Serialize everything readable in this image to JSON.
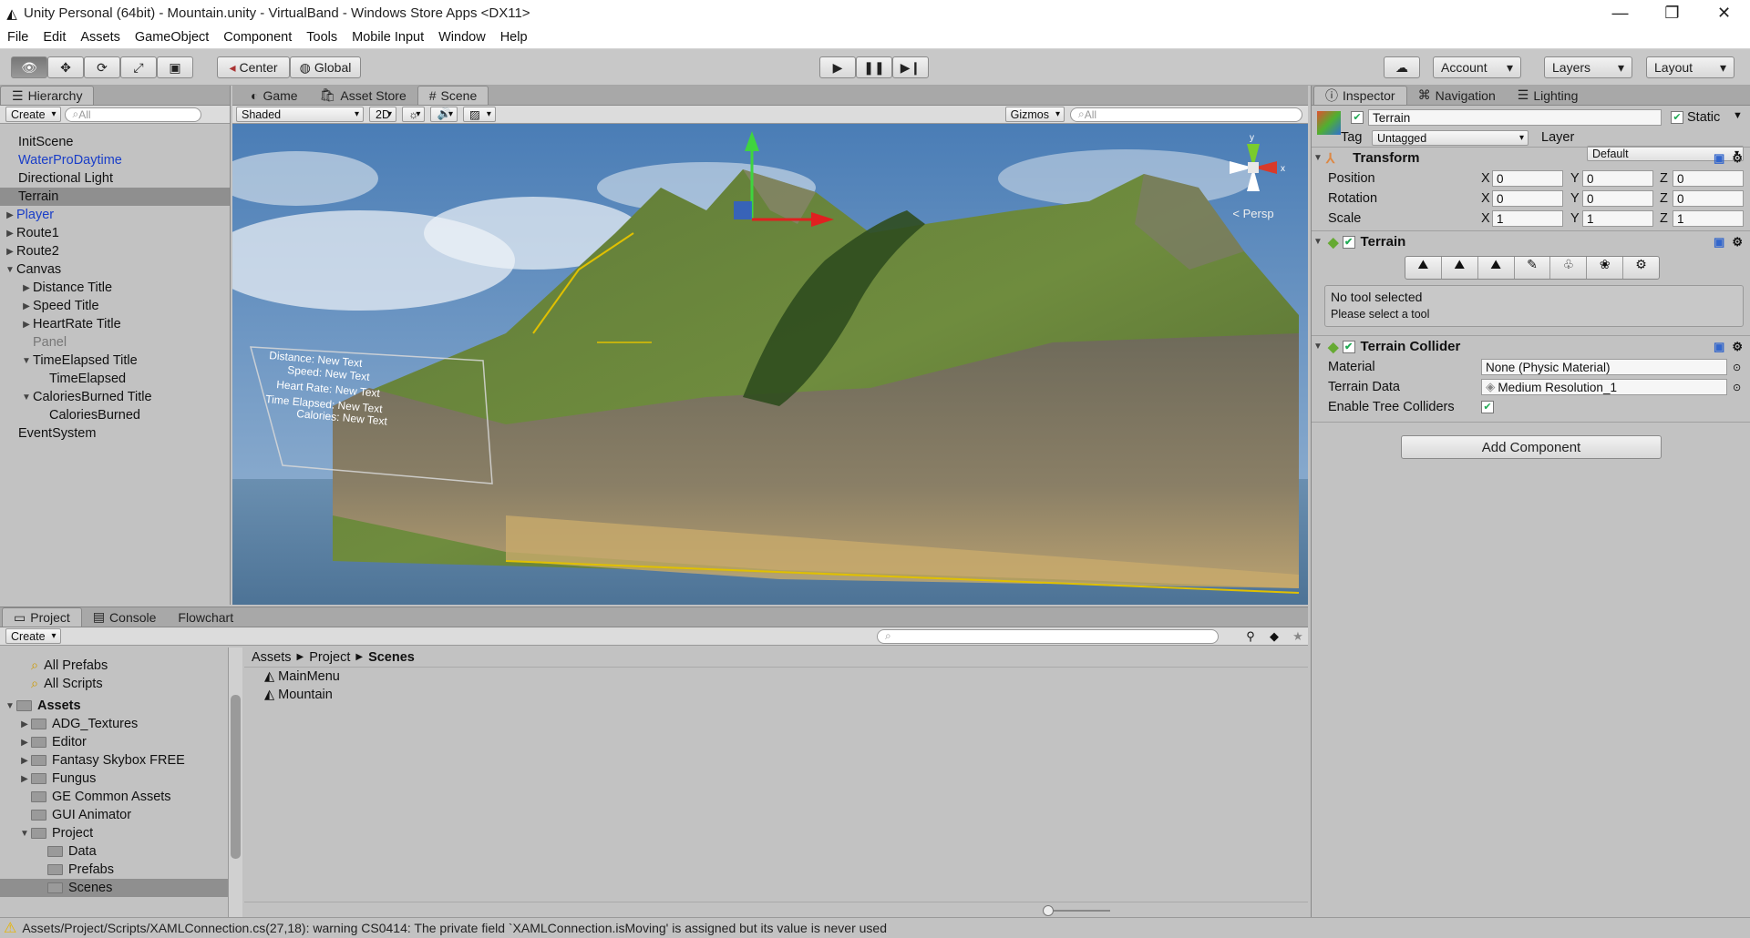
{
  "window": {
    "title": "Unity Personal (64bit) - Mountain.unity - VirtualBand - Windows Store Apps <DX11>"
  },
  "menu": [
    "File",
    "Edit",
    "Assets",
    "GameObject",
    "Component",
    "Tools",
    "Mobile Input",
    "Window",
    "Help"
  ],
  "toolbar": {
    "center": "Center",
    "global": "Global",
    "account": "Account",
    "layers": "Layers",
    "layout": "Layout"
  },
  "hierarchy": {
    "tab": "Hierarchy",
    "create": "Create",
    "search_placeholder": "All",
    "items": [
      {
        "label": "InitScene"
      },
      {
        "label": "WaterProDaytime"
      },
      {
        "label": "Directional Light"
      },
      {
        "label": "Terrain"
      },
      {
        "label": "Player"
      },
      {
        "label": "Route1"
      },
      {
        "label": "Route2"
      },
      {
        "label": "Canvas"
      },
      {
        "label": "Distance Title"
      },
      {
        "label": "Speed Title"
      },
      {
        "label": "HeartRate Title"
      },
      {
        "label": "Panel"
      },
      {
        "label": "TimeElapsed Title"
      },
      {
        "label": "TimeElapsed"
      },
      {
        "label": "CaloriesBurned Title"
      },
      {
        "label": "CaloriesBurned"
      },
      {
        "label": "EventSystem"
      }
    ]
  },
  "center_tabs": [
    "Game",
    "Asset Store",
    "Scene"
  ],
  "scene": {
    "shading": "Shaded",
    "mode2d": "2D",
    "gizmos": "Gizmos",
    "search_placeholder": "All",
    "persp": "< Persp",
    "overlay": [
      "Distance: New Text",
      "Speed: New Text",
      "Heart Rate: New Text",
      "Time Elapsed: New Text",
      "Calories: New Text"
    ]
  },
  "inspector": {
    "tabs": [
      "Inspector",
      "Navigation",
      "Lighting"
    ],
    "object_name": "Terrain",
    "static_label": "Static",
    "tag_label": "Tag",
    "tag_value": "Untagged",
    "layer_label": "Layer",
    "layer_value": "Default",
    "transform": {
      "title": "Transform",
      "rows": [
        {
          "label": "Position",
          "x": "0",
          "y": "0",
          "z": "0"
        },
        {
          "label": "Rotation",
          "x": "0",
          "y": "0",
          "z": "0"
        },
        {
          "label": "Scale",
          "x": "1",
          "y": "1",
          "z": "1"
        }
      ],
      "axis": [
        "X",
        "Y",
        "Z"
      ]
    },
    "terrain": {
      "title": "Terrain",
      "info1": "No tool selected",
      "info2": "Please select a tool"
    },
    "collider": {
      "title": "Terrain Collider",
      "material_label": "Material",
      "material_value": "None (Physic Material)",
      "data_label": "Terrain Data",
      "data_value": "Medium Resolution_1",
      "trees_label": "Enable Tree Colliders"
    },
    "add_component": "Add Component"
  },
  "project": {
    "tabs": [
      "Project",
      "Console",
      "Flowchart"
    ],
    "create": "Create",
    "tree": [
      {
        "label": "All Prefabs",
        "type": "search"
      },
      {
        "label": "All Scripts",
        "type": "search"
      },
      {
        "label": "Assets",
        "type": "root"
      },
      {
        "label": "ADG_Textures",
        "type": "folder"
      },
      {
        "label": "Editor",
        "type": "folder"
      },
      {
        "label": "Fantasy Skybox FREE",
        "type": "folder"
      },
      {
        "label": "Fungus",
        "type": "folder"
      },
      {
        "label": "GE Common Assets",
        "type": "folder"
      },
      {
        "label": "GUI Animator",
        "type": "folder"
      },
      {
        "label": "Project",
        "type": "folder"
      },
      {
        "label": "Data",
        "type": "sub"
      },
      {
        "label": "Prefabs",
        "type": "sub"
      },
      {
        "label": "Scenes",
        "type": "sub"
      }
    ],
    "breadcrumb": [
      "Assets",
      "Project",
      "Scenes"
    ],
    "files": [
      "MainMenu",
      "Mountain"
    ]
  },
  "status": {
    "message": "Assets/Project/Scripts/XAMLConnection.cs(27,18): warning CS0414: The private field `XAMLConnection.isMoving' is assigned but its value is never used"
  },
  "colors": {
    "selection": "#8f8f8f",
    "prefab_blue": "#1a3ec8",
    "warning": "#e8b400"
  }
}
